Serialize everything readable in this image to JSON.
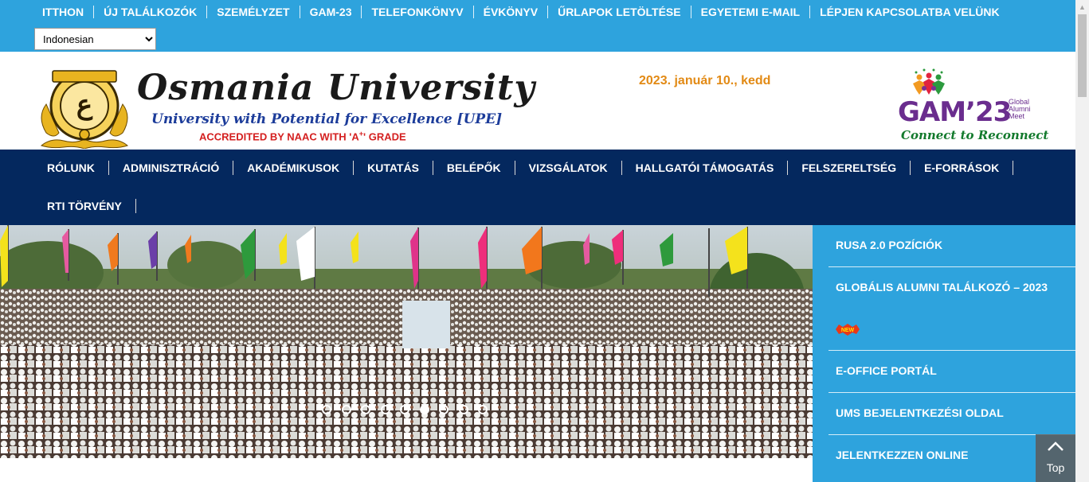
{
  "topbar": {
    "links": [
      "ITTHON",
      "ÚJ TALÁLKOZÓK",
      "SZEMÉLYZET",
      "GAM-23",
      "TELEFONKÖNYV",
      "ÉVKÖNYV",
      "ŰRLAPOK LETÖLTÉSE",
      "EGYETEMI E-MAIL",
      "LÉPJEN KAPCSOLATBA VELÜNK"
    ],
    "language_selected": "Indonesian",
    "bg_color": "#2ea3dd"
  },
  "header": {
    "title": "Osmania University",
    "tagline": "University with Potential for Excellence [UPE]",
    "accreditation_prefix": "ACCREDITED BY NAAC WITH ",
    "accreditation_grade": "'A",
    "accreditation_sup": "+",
    "accreditation_suffix": "' GRADE",
    "date": "2023. január 10., kedd",
    "gam_logo": {
      "word": "GAM’23",
      "sub": "Global Alumni Meet",
      "tagline": "Connect to Reconnect"
    }
  },
  "mainnav": {
    "row1": [
      "RÓLUNK",
      "ADMINISZTRÁCIÓ",
      "AKADÉMIKUSOK",
      "KUTATÁS",
      "BELÉPŐK",
      "VIZSGÁLATOK",
      "HALLGATÓI TÁMOGATÁS",
      "FELSZERELTSÉG",
      "E-FORRÁSOK"
    ],
    "row2": [
      "RTI TÖRVÉNY"
    ],
    "bg_color": "#04285e"
  },
  "slider": {
    "dot_count": 9,
    "active_index": 5
  },
  "sidepanel": {
    "items": [
      "RUSA 2.0 POZÍCIÓK",
      "GLOBÁLIS ALUMNI TALÁLKOZÓ – 2023",
      "E-OFFICE PORTÁL",
      "UMS BEJELENTKEZÉSI OLDAL",
      "JELENTKEZZEN ONLINE"
    ],
    "new_badge": "NEW"
  },
  "top_button": {
    "label": "Top"
  }
}
